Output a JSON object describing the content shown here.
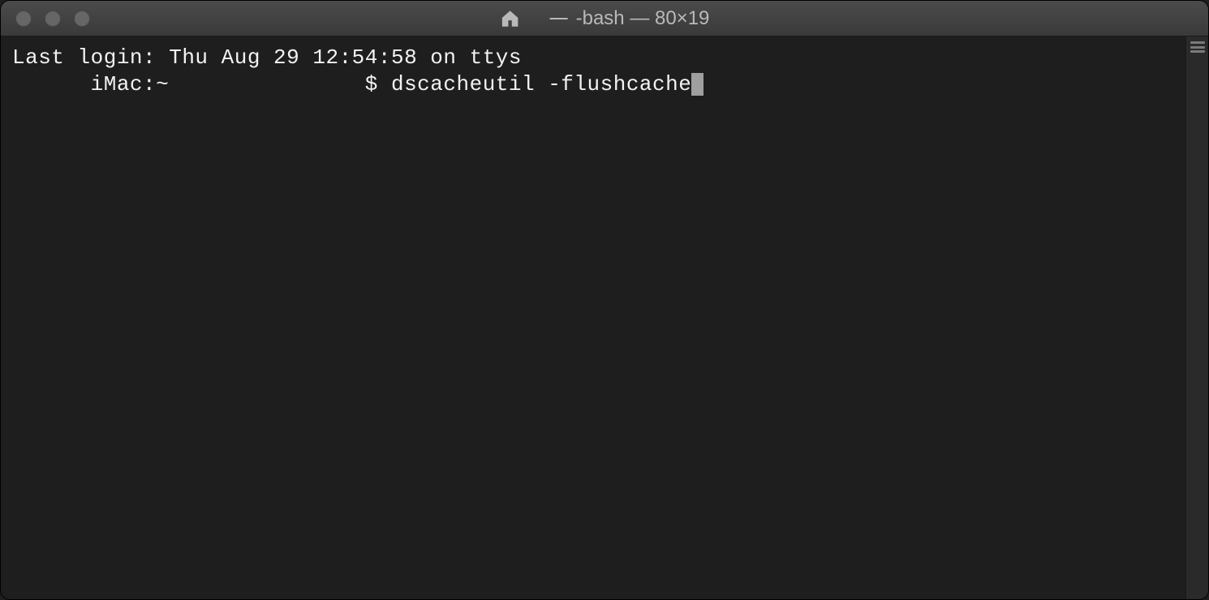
{
  "window": {
    "title_prefix_dash": "—",
    "title": "-bash — 80×19"
  },
  "terminal": {
    "last_login_line": "Last login: Thu Aug 29 12:54:58 on ttys",
    "prompt_line": "      iMac:~               $ dscacheutil -flushcache"
  }
}
